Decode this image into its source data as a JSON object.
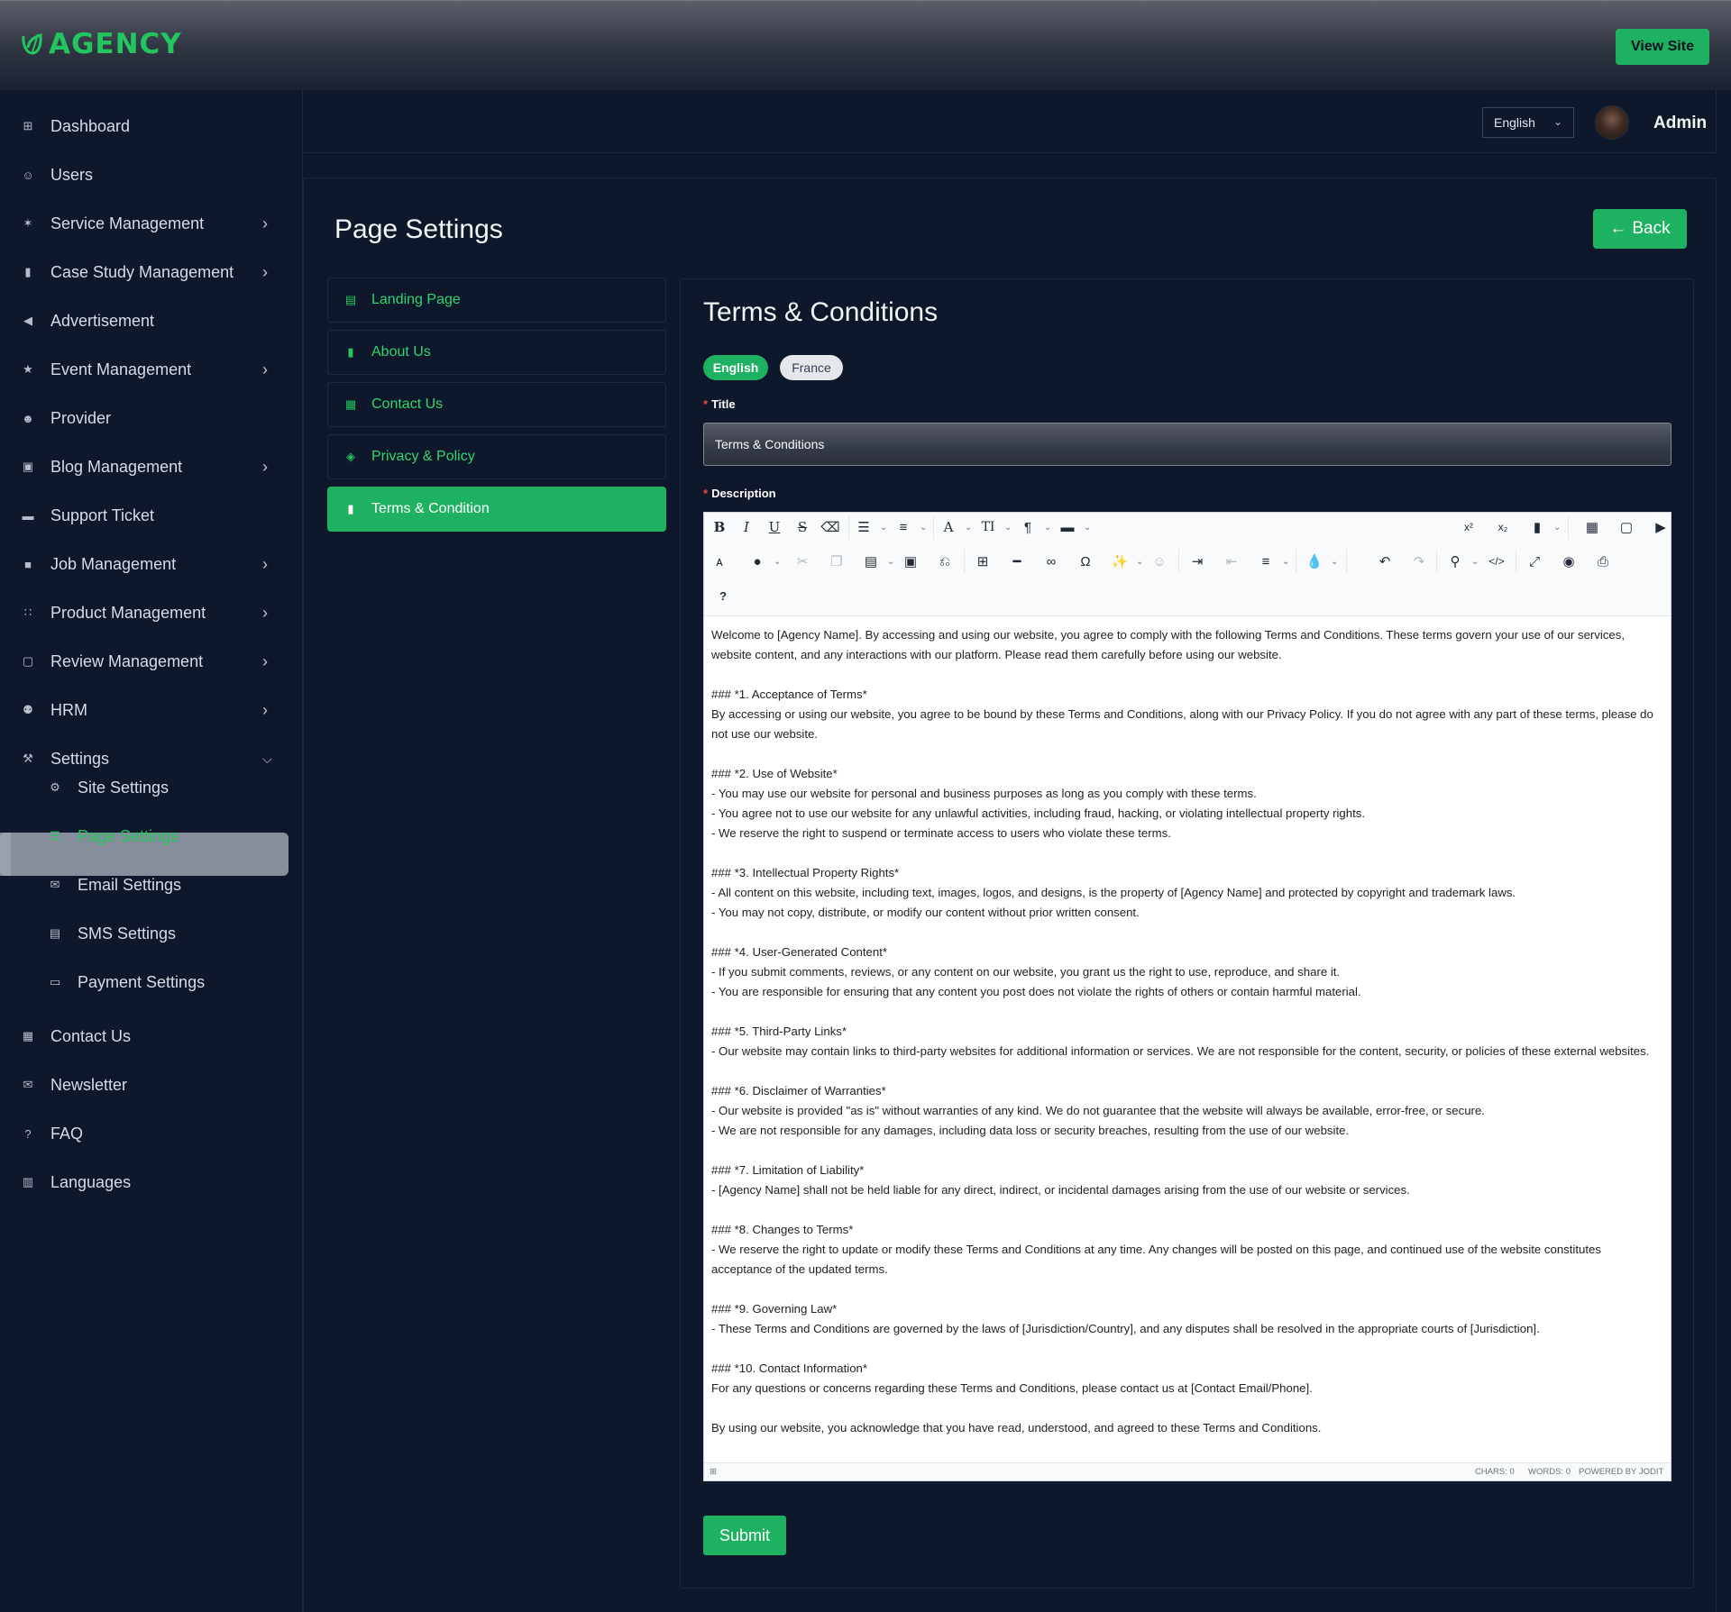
{
  "app": {
    "logo_text": "AGENCY",
    "view_site_label": "View Site"
  },
  "header": {
    "language": "English",
    "user_name": "Admin"
  },
  "sidebar": {
    "items": [
      {
        "label": "Dashboard",
        "icon": "dashboard-icon"
      },
      {
        "label": "Users",
        "icon": "users-icon"
      },
      {
        "label": "Service Management",
        "icon": "service-icon"
      },
      {
        "label": "Case Study Management",
        "icon": "document-icon"
      },
      {
        "label": "Advertisement",
        "icon": "megaphone-icon"
      },
      {
        "label": "Event Management",
        "icon": "trophy-icon"
      },
      {
        "label": "Provider",
        "icon": "provider-icon"
      },
      {
        "label": "Blog Management",
        "icon": "blog-icon"
      },
      {
        "label": "Support Ticket",
        "icon": "ticket-icon"
      },
      {
        "label": "Job Management",
        "icon": "briefcase-icon"
      },
      {
        "label": "Product Management",
        "icon": "grid-icon"
      },
      {
        "label": "Review Management",
        "icon": "review-icon"
      },
      {
        "label": "HRM",
        "icon": "team-icon"
      },
      {
        "label": "Settings",
        "icon": "wrench-icon"
      }
    ],
    "settings_sub": [
      {
        "label": "Site Settings",
        "icon": "gear-icon"
      },
      {
        "label": "Page Settings",
        "icon": "page-icon"
      },
      {
        "label": "Email Settings",
        "icon": "mail-settings-icon"
      },
      {
        "label": "SMS Settings",
        "icon": "sms-icon"
      },
      {
        "label": "Payment Settings",
        "icon": "card-icon"
      }
    ],
    "bottom": [
      {
        "label": "Contact Us",
        "icon": "contact-icon"
      },
      {
        "label": "Newsletter",
        "icon": "envelope-icon"
      },
      {
        "label": "FAQ",
        "icon": "question-icon"
      },
      {
        "label": "Languages",
        "icon": "language-icon"
      }
    ]
  },
  "main": {
    "page_title": "Page Settings",
    "back_label": "Back",
    "tabs": [
      {
        "label": "Landing Page"
      },
      {
        "label": "About Us"
      },
      {
        "label": "Contact Us"
      },
      {
        "label": "Privacy & Policy"
      },
      {
        "label": "Terms & Condition"
      }
    ],
    "section_title": "Terms & Conditions",
    "lang_tabs": {
      "english": "English",
      "france": "France"
    },
    "title_label": "Title",
    "title_value": "Terms & Conditions",
    "description_label": "Description",
    "submit_label": "Submit",
    "editor": {
      "help_label": "?",
      "status_chars": "CHARS: 0",
      "status_words": "WORDS: 0",
      "status_powered": "POWERED BY JODIT",
      "content": [
        "Welcome to [Agency Name]. By accessing and using our website, you agree to comply with the following Terms and Conditions. These terms govern your use of our services, website content, and any interactions with our platform. Please read them carefully before using our website.",
        "",
        "### *1. Acceptance of Terms*",
        "By accessing or using our website, you agree to be bound by these Terms and Conditions, along with our Privacy Policy. If you do not agree with any part of these terms, please do not use our website.",
        "",
        "### *2. Use of Website*",
        "- You may use our website for personal and business purposes as long as you comply with these terms.",
        "- You agree not to use our website for any unlawful activities, including fraud, hacking, or violating intellectual property rights.",
        "- We reserve the right to suspend or terminate access to users who violate these terms.",
        "",
        "### *3. Intellectual Property Rights*",
        "- All content on this website, including text, images, logos, and designs, is the property of [Agency Name] and protected by copyright and trademark laws.",
        "- You may not copy, distribute, or modify our content without prior written consent.",
        "",
        "### *4. User-Generated Content*",
        "- If you submit comments, reviews, or any content on our website, you grant us the right to use, reproduce, and share it.",
        "- You are responsible for ensuring that any content you post does not violate the rights of others or contain harmful material.",
        "",
        "### *5. Third-Party Links*",
        "- Our website may contain links to third-party websites for additional information or services. We are not responsible for the content, security, or policies of these external websites.",
        "",
        "### *6. Disclaimer of Warranties*",
        "- Our website is provided \"as is\" without warranties of any kind. We do not guarantee that the website will always be available, error-free, or secure.",
        "- We are not responsible for any damages, including data loss or security breaches, resulting from the use of our website.",
        "",
        "### *7. Limitation of Liability*",
        "- [Agency Name] shall not be held liable for any direct, indirect, or incidental damages arising from the use of our website or services.",
        "",
        "### *8. Changes to Terms*",
        "- We reserve the right to update or modify these Terms and Conditions at any time. Any changes will be posted on this page, and continued use of the website constitutes acceptance of the updated terms.",
        "",
        "### *9. Governing Law*",
        "- These Terms and Conditions are governed by the laws of [Jurisdiction/Country], and any disputes shall be resolved in the appropriate courts of [Jurisdiction].",
        "",
        "### *10. Contact Information*",
        "For any questions or concerns regarding these Terms and Conditions, please contact us at [Contact Email/Phone].",
        "",
        "By using our website, you acknowledge that you have read, understood, and agreed to these Terms and Conditions."
      ]
    }
  },
  "colors": {
    "accent": "#1fb162",
    "brand": "#22c55e",
    "bg": "#0f172b"
  }
}
